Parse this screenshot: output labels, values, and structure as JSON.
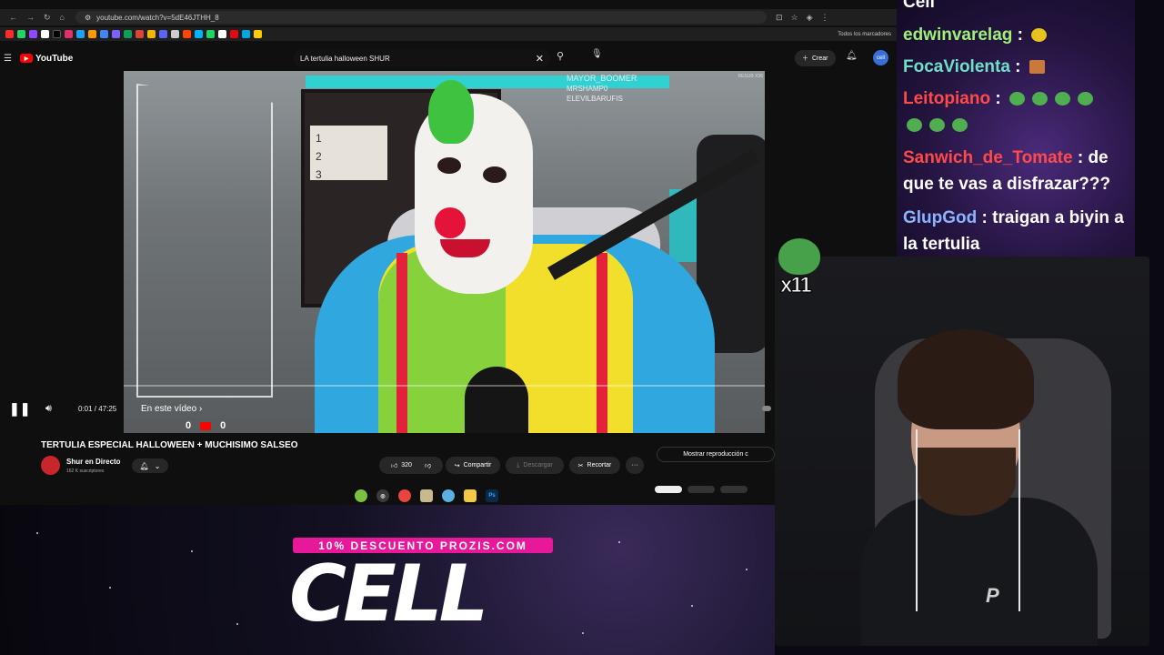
{
  "browser": {
    "url": "youtube.com/watch?v=5dE46JTHH_8",
    "bookmarks_all": "Todos los marcadores"
  },
  "youtube": {
    "logo_text": "YouTube",
    "search_value": "LA tertulia halloween SHUR",
    "create_label": "Crear",
    "avatar_text": "cell"
  },
  "video": {
    "overlay_text": {
      "mods": [
        "MAYOR_BOOMER",
        "MRSHAMP0",
        "ELEVILBARUFIS"
      ],
      "resub": "RESUB X36",
      "shelf_numbers": [
        "1",
        "2",
        "3"
      ]
    },
    "in_video_label": "En este vídeo",
    "counter_left": "0",
    "counter_right": "0",
    "time": "0:01 / 47:25",
    "played_fraction": 0.0004
  },
  "meta": {
    "title": "TERTULIA ESPECIAL HALLOWEEN + MUCHISIMO SALSEO",
    "channel_name": "Shur en Directo",
    "channel_subs": "162 K suscriptores",
    "likes": "320",
    "share": "Compartir",
    "download": "Descargar",
    "clip": "Recortar",
    "more": "···",
    "show_playback": "Mostrar reproducción c"
  },
  "banner": {
    "promo": "10% DESCUENTO PROZIS.COM",
    "big_text": "CELL"
  },
  "chat": {
    "top_partial": "Cell",
    "messages": [
      {
        "user": "edwinvarelag",
        "sep": " : ",
        "text": "",
        "color": "#9ff07a",
        "emotes": [
          "#e8c21d"
        ]
      },
      {
        "user": "FocaViolenta",
        "sep": " : ",
        "text": "",
        "color": "#6fe0c8",
        "emotes": [
          "#c9793a"
        ]
      },
      {
        "user": "Leitopiano",
        "sep": " : ",
        "text": "",
        "color": "#ff4a4a",
        "emotes": [
          "#4fae4f",
          "#4fae4f",
          "#4fae4f",
          "#4fae4f",
          "#4fae4f",
          "#4fae4f",
          "#4fae4f"
        ]
      },
      {
        "user": "Sanwich_de_Tomate",
        "sep": " : ",
        "text": "de que te vas a disfrazar???",
        "color": "#ff4a4a"
      },
      {
        "user": "GlupGod",
        "sep": " : ",
        "text": "traigan a biyin a la tertulia",
        "color": "#8ab4ff"
      }
    ]
  },
  "floating_emote": {
    "count": "x11"
  }
}
